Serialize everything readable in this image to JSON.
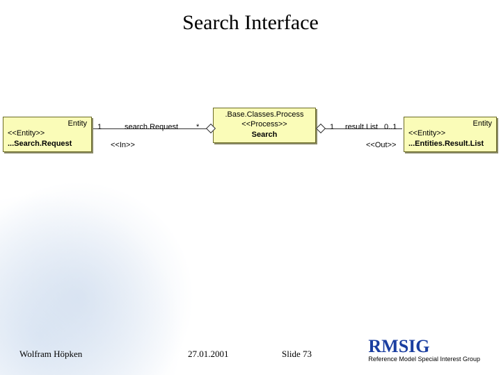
{
  "title": "Search Interface",
  "diagram": {
    "leftBox": {
      "title": "Entity",
      "stereo": "<<Entity>>",
      "name": "...Search.Request"
    },
    "centerBox": {
      "title": ".Base.Classes.Process",
      "stereo": "<<Process>>",
      "name": "Search"
    },
    "rightBox": {
      "title": "Entity",
      "stereo": "<<Entity>>",
      "name": "...Entities.Result.List"
    },
    "leftAssoc": {
      "leftMult": "1",
      "label": "search.Request",
      "rightMult": "*"
    },
    "leftDep": "<<In>>",
    "rightAssoc": {
      "leftMult": "1",
      "label": "result.List",
      "rightMult": "0..1"
    },
    "rightDep": "<<Out>>"
  },
  "footer": {
    "author": "Wolfram Höpken",
    "date": "27.01.2001",
    "slide": "Slide 73",
    "logo": "RMSIG",
    "logoSub": "Reference Model Special Interest Group"
  }
}
